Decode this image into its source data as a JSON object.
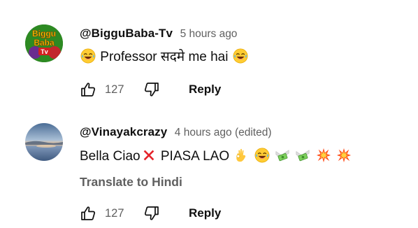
{
  "comments": [
    {
      "author": "@BigguBaba-Tv",
      "time": "5 hours ago",
      "text_1": "Professor सदमे me hai",
      "avatar_text_1": "Biggu",
      "avatar_text_2": "Baba",
      "avatar_text_3": "Tv",
      "likes": "127",
      "reply_label": "Reply",
      "emoji_before": "laughing-tears",
      "emoji_after": "laughing-tears"
    },
    {
      "author": "@Vinayakcrazy",
      "time": "4 hours ago (edited)",
      "text_part_1": "Bella Ciao",
      "text_part_2": " PIASA LAO",
      "translate_label": "Translate to Hindi",
      "likes": "127",
      "reply_label": "Reply",
      "emojis": [
        "cross-mark",
        "ok-hand",
        "laughing-tears",
        "money-wings",
        "money-wings",
        "collision",
        "collision"
      ]
    }
  ],
  "colors": {
    "text_primary": "#0f0f0f",
    "text_secondary": "#606060",
    "background": "#ffffff"
  }
}
